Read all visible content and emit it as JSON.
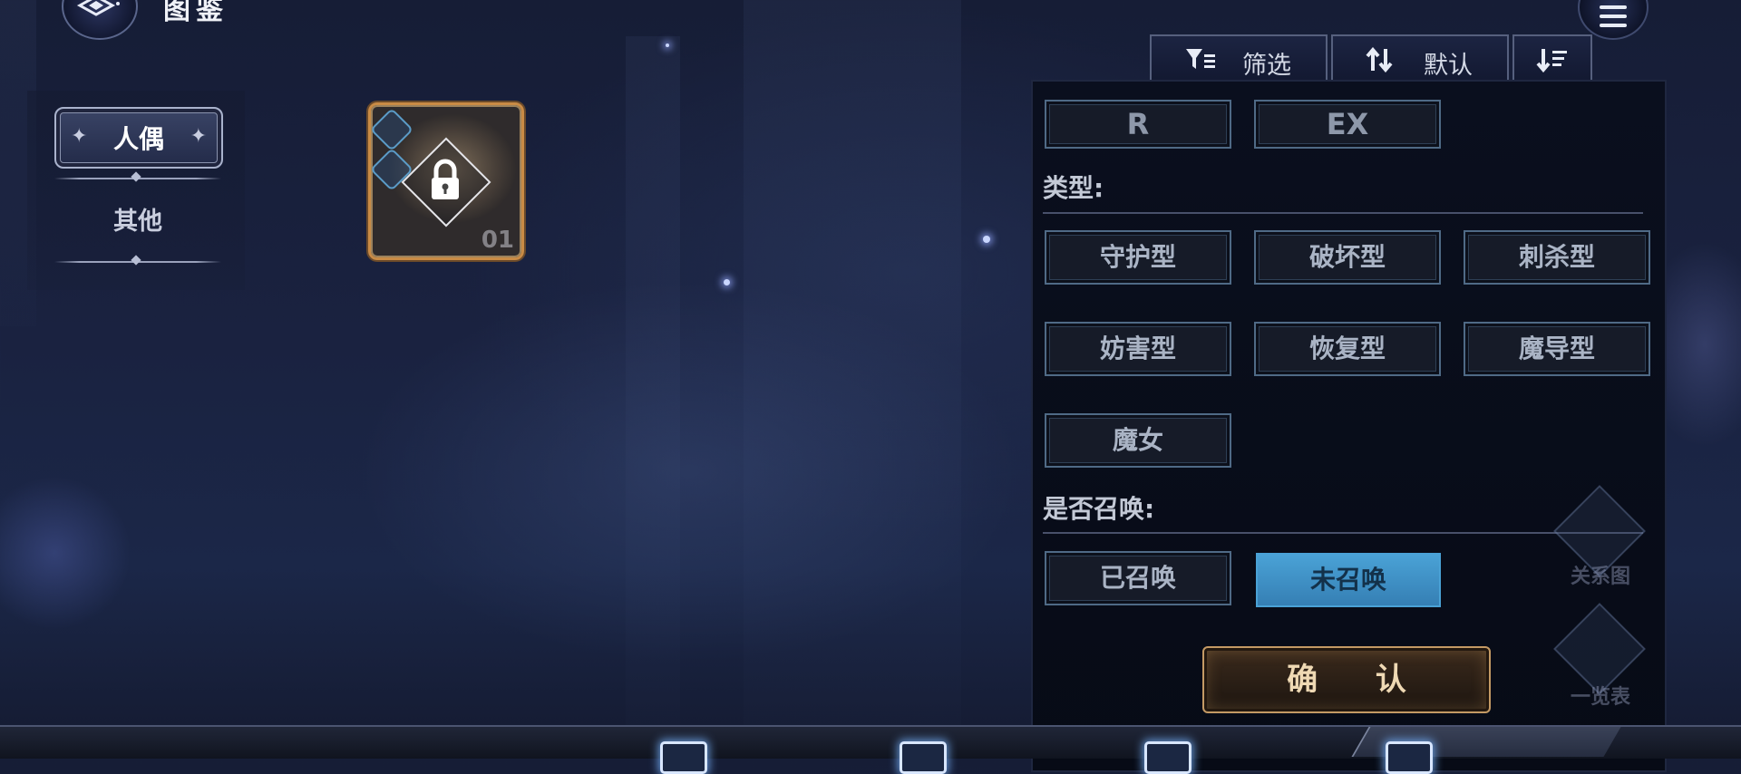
{
  "header": {
    "title": "图鉴"
  },
  "sidebar": {
    "categories": [
      {
        "label": "人偶",
        "active": true
      },
      {
        "label": "其他",
        "active": false
      }
    ]
  },
  "toolbar": {
    "filter_label": "筛选",
    "sort_label": "默认",
    "filter_icon": "filter-icon",
    "sort_icon": "sort-updown-icon",
    "order_icon": "sort-order-icon"
  },
  "card": {
    "number": "01",
    "locked": true
  },
  "filter_panel": {
    "rarity_options": [
      "R",
      "EX"
    ],
    "type_label": "类型:",
    "type_options": [
      "守护型",
      "破坏型",
      "刺杀型",
      "妨害型",
      "恢复型",
      "魔导型",
      "魔女"
    ],
    "summon_label": "是否召唤:",
    "summon_options": [
      {
        "label": "已召唤",
        "selected": false
      },
      {
        "label": "未召唤",
        "selected": true
      }
    ],
    "confirm_label": "确 认"
  },
  "side_shortcuts": [
    {
      "label": "关系图",
      "icon": "relation-map-icon"
    },
    {
      "label": "一览表",
      "icon": "overview-list-icon"
    }
  ],
  "colors": {
    "selected_accent": "#4aa2d6",
    "confirm_gold": "#c49a64",
    "card_border": "#c98b45"
  }
}
